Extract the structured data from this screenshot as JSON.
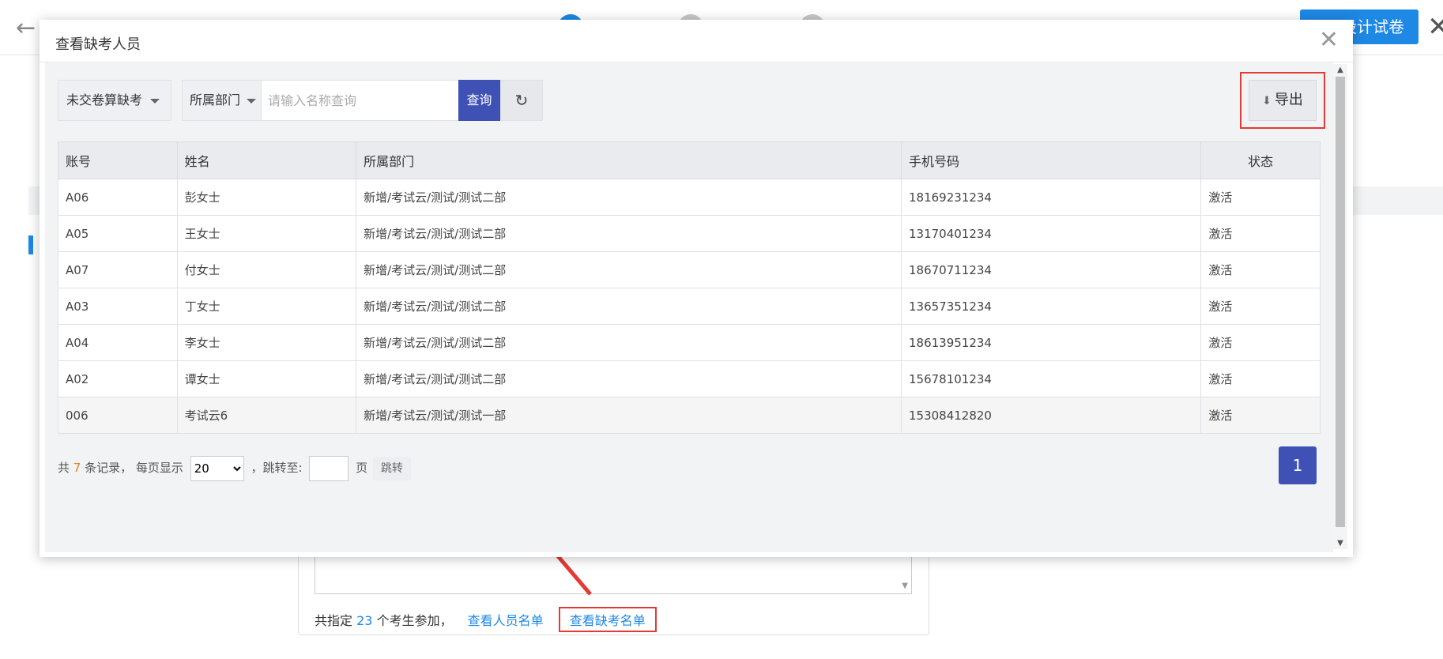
{
  "background": {
    "design_button": "设计试卷",
    "summary": {
      "prefix": "共指定",
      "count": "23",
      "suffix": "个考生参加，",
      "view_people_link": "查看人员名单",
      "view_absent_link": "查看缺考名单"
    }
  },
  "modal": {
    "title": "查看缺考人员",
    "filter_select": "未交卷算缺考",
    "department_select": "所属部门",
    "search_placeholder": "请输入名称查询",
    "query_button": "查询",
    "export_button": "导出",
    "table": {
      "columns": [
        "账号",
        "姓名",
        "所属部门",
        "手机号码",
        "状态"
      ],
      "rows": [
        [
          "A06",
          "彭女士",
          "新增/考试云/测试/测试二部",
          "18169231234",
          "激活"
        ],
        [
          "A05",
          "王女士",
          "新增/考试云/测试/测试二部",
          "13170401234",
          "激活"
        ],
        [
          "A07",
          "付女士",
          "新增/考试云/测试/测试二部",
          "18670711234",
          "激活"
        ],
        [
          "A03",
          "丁女士",
          "新增/考试云/测试/测试二部",
          "13657351234",
          "激活"
        ],
        [
          "A04",
          "李女士",
          "新增/考试云/测试/测试二部",
          "18613951234",
          "激活"
        ],
        [
          "A02",
          "谭女士",
          "新增/考试云/测试/测试二部",
          "15678101234",
          "激活"
        ],
        [
          "006",
          "考试云6",
          "新增/考试云/测试/测试一部",
          "15308412820",
          "激活"
        ]
      ]
    },
    "pagination": {
      "total_prefix": "共",
      "total": "7",
      "total_suffix": "条记录，",
      "per_page_label": "每页显示",
      "per_page_value": "20",
      "jump_label": "，跳转至:",
      "page_unit": "页",
      "jump_button": "跳转",
      "current_page": "1"
    }
  },
  "colors": {
    "primary": "#3f51b5",
    "link": "#1e88e5",
    "highlight": "#e53935"
  }
}
